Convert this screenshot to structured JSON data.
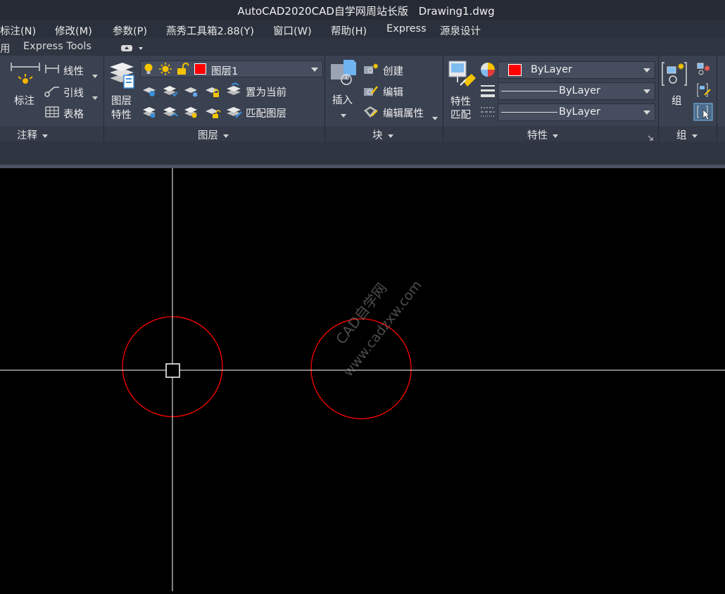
{
  "window": {
    "title": "AutoCAD2020CAD自学网周站长版",
    "file": "Drawing1.dwg"
  },
  "menu": [
    "标注(N)",
    "修改(M)",
    "参数(P)",
    "燕秀工具箱2.88(Y)",
    "窗口(W)",
    "帮助(H)",
    "Express",
    "源泉设计"
  ],
  "tabs": {
    "partial": "用",
    "express_tools": "Express Tools"
  },
  "ribbon": {
    "annotation": {
      "title": "注释",
      "dimension": "标注",
      "linear": "线性",
      "leader": "引线",
      "table": "表格"
    },
    "layers": {
      "title": "图层",
      "properties_line1": "图层",
      "properties_line2": "特性",
      "current_layer": "图层1",
      "current_layer_color": "#ff0000",
      "set_current": "置为当前",
      "match_layer": "匹配图层"
    },
    "block": {
      "title": "块",
      "insert": "插入",
      "create": "创建",
      "edit": "编辑",
      "edit_attributes": "编辑属性"
    },
    "properties": {
      "title": "特性",
      "match_line1": "特性",
      "match_line2": "匹配",
      "color": "ByLayer",
      "color_swatch": "#ff0000",
      "linetype": "ByLayer",
      "lineweight": "ByLayer"
    },
    "groups": {
      "title": "组",
      "group": "组"
    }
  },
  "canvas": {
    "background": "#000000",
    "circle_color": "#ff0000",
    "crosshair_color": "#ffffff",
    "watermark_line1": "CAD自学网",
    "watermark_line2": "www.cadzxw.com"
  },
  "colors": {
    "accent": "#ff0000",
    "ribbon_bg": "#3a4150"
  }
}
